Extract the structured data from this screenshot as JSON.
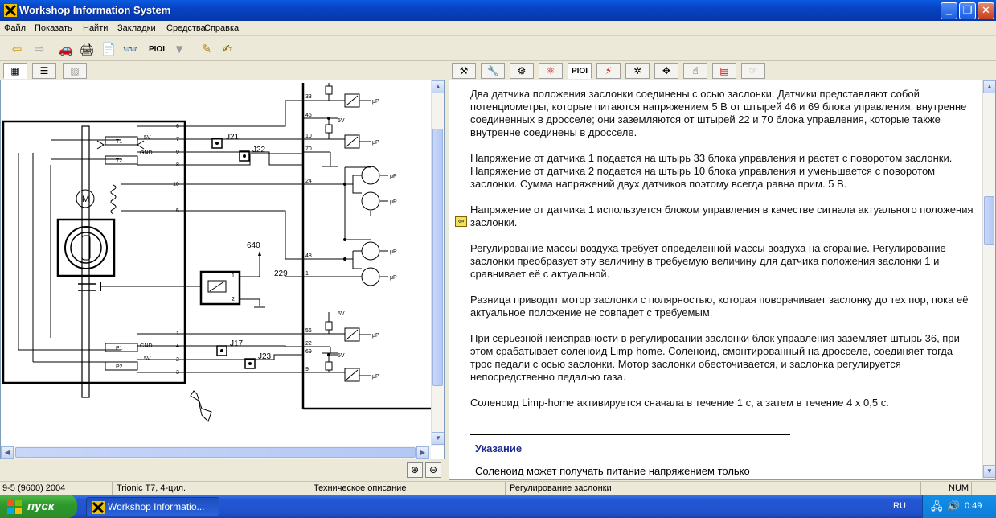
{
  "window": {
    "title": "Workshop Information System"
  },
  "menu": [
    "Файл",
    "Показать",
    "Найти",
    "Закладки",
    "Средства",
    "Справка"
  ],
  "toolbar": {
    "buttons": [
      {
        "name": "back-arrow-icon",
        "glyph": "⇦"
      },
      {
        "name": "forward-arrow-icon",
        "glyph": "⇨"
      },
      {
        "name": "car-icon",
        "glyph": "🚗"
      },
      {
        "name": "print-icon",
        "glyph": "🖨"
      },
      {
        "name": "document-export-icon",
        "glyph": "📄"
      },
      {
        "name": "binoculars-icon",
        "glyph": "👓"
      },
      {
        "name": "pioi-button",
        "glyph": "PIOI"
      },
      {
        "name": "filter-icon",
        "glyph": "▼"
      },
      {
        "name": "highlight-pen-icon",
        "glyph": "✎"
      },
      {
        "name": "note-edit-icon",
        "glyph": "✍"
      }
    ]
  },
  "left_tabs": [
    {
      "name": "tree-tab-icon",
      "glyph": "▦"
    },
    {
      "name": "list-tab-icon",
      "glyph": "☰"
    },
    {
      "name": "graphic-tab-icon",
      "glyph": "▨"
    }
  ],
  "right_tabs": [
    {
      "name": "tools-tab-icon",
      "glyph": "⚒"
    },
    {
      "name": "wrench-tab-icon",
      "glyph": "🔧"
    },
    {
      "name": "engine-tab-icon",
      "glyph": "⚙"
    },
    {
      "name": "component-tab-icon",
      "glyph": "⚛"
    },
    {
      "name": "pioi-tab",
      "glyph": "PIOI"
    },
    {
      "name": "sensor-tab-icon",
      "glyph": "⚡"
    },
    {
      "name": "gear-tab-icon",
      "glyph": "✲"
    },
    {
      "name": "move-tab-icon",
      "glyph": "✥"
    },
    {
      "name": "hand-tab-icon",
      "glyph": "☝"
    },
    {
      "name": "manual-tab-icon",
      "glyph": "▤"
    },
    {
      "name": "disabled-tab-icon",
      "glyph": "☞"
    }
  ],
  "diagram": {
    "pins_left": [
      "6",
      "7",
      "9",
      "8",
      "10",
      "5",
      "1",
      "4",
      "2",
      "3"
    ],
    "pins_right": [
      "33",
      "46",
      "10",
      "70",
      "24",
      "48",
      "1",
      "56",
      "22",
      "69",
      "9"
    ],
    "sensors": [
      "T1",
      "T2",
      "P1",
      "P2"
    ],
    "sensor_labels": [
      "5V",
      "GND",
      "GND",
      "5V"
    ],
    "junctions": [
      "J21",
      "J22",
      "J17",
      "J23"
    ],
    "wire_labels": [
      "640",
      "229"
    ],
    "motor_label": "M",
    "relay_pins": [
      "1",
      "2"
    ],
    "supply_label": "5V",
    "output_label": "μP"
  },
  "document": {
    "paragraphs": [
      "Два датчика положения заслонки соединены с осью заслонки. Датчики представляют собой потенциометры, которые питаются напряжением 5 В от штырей 46 и 69 блока управления, внутренне соединенных в дросселе; они заземляются от штырей 22 и 70 блока управления, которые также внутренне соединены в дросселе.",
      "Напряжение от датчика 1 подается на штырь 33 блока управления и растет с поворотом заслонки. Напряжение от датчика 2 подается на штырь 10 блока управления и уменьшается с поворотом заслонки. Сумма напряжений двух датчиков поэтому всегда равна прим. 5 В.",
      "Напряжение от датчика 1 используется блоком управления в качестве сигнала актуального положения заслонки.",
      "Регулирование массы воздуха требует определенной массы воздуха на сгорание. Регулирование заслонки преобразует эту величину в требуемую величину для датчика положения заслонки 1 и сравнивает её с актуальной.",
      "Разница приводит мотор заслонки с полярностью, которая поворачивает заслонку до тех пор, пока её актуальное положение не совпадет с требуемым.",
      "При серьезной неисправности в регулировании заслонки блок управления заземляет штырь 36, при этом срабатывает соленоид Limp-home. Соленоид, смонтированный на дросселе, соединяет тогда трос педали с осью заслонки. Мотор заслонки обесточивается, и заслонка регулируется непосредственно педалью газа.",
      "Соленоид Limp-home активируется сначала в течение 1 с, а затем в течение 4 x 0,5 с."
    ],
    "note_title": "Указание",
    "note_text": "Соленоид может получать питание напряжением только"
  },
  "status": {
    "model": "9-5 (9600) 2004",
    "engine": "Trionic T7, 4-цил.",
    "section": "Техническое описание",
    "topic": "Регулирование заслонки",
    "num": "NUM"
  },
  "taskbar": {
    "start": "пуск",
    "task": "Workshop Informatio...",
    "lang": "RU",
    "clock": "0:49"
  }
}
